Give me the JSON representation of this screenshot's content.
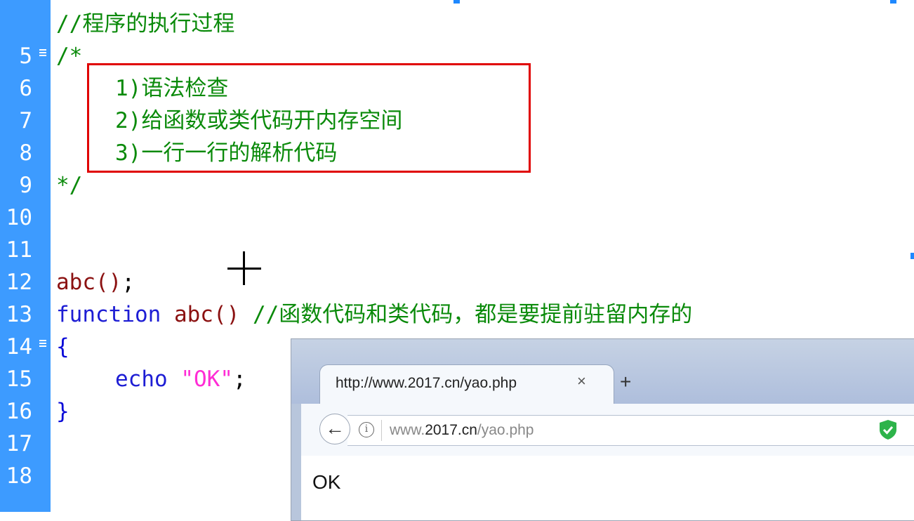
{
  "editor": {
    "lines": [
      {
        "num": "5",
        "text": "//程序的执行过程"
      },
      {
        "num": "6",
        "text": "/*"
      },
      {
        "num": "7",
        "text": "1)语法检查"
      },
      {
        "num": "8",
        "text": "2)给函数或类代码开内存空间"
      },
      {
        "num": "9",
        "text": "3)一行一行的解析代码"
      },
      {
        "num": "10",
        "text": "*/"
      },
      {
        "num": "11",
        "text": ""
      },
      {
        "num": "12",
        "text": ""
      },
      {
        "num": "13",
        "call": "abc",
        "paren": "()",
        "semi": ";"
      },
      {
        "num": "14",
        "kw": "function",
        "name": "abc",
        "paren": "()",
        "comment": "//函数代码和类代码，都是要提前驻留内存的"
      },
      {
        "num": "15",
        "text": "{"
      },
      {
        "num": "16",
        "kw": "echo",
        "str": "\"OK\"",
        "semi": ";"
      },
      {
        "num": "17",
        "text": "}"
      },
      {
        "num": "18",
        "text": ""
      }
    ],
    "colors": {
      "gutter": "#3d9bff",
      "comment": "#0a8a0a",
      "keyword": "#1d1dd4",
      "function_name": "#8b1111",
      "string": "#ff2dd5",
      "highlight_box": "#e00000"
    }
  },
  "browser": {
    "tab_title": "http://www.2017.cn/yao.php",
    "tab_close": "×",
    "new_tab": "+",
    "back": "←",
    "info_icon": "i",
    "url_prefix": "www.",
    "url_domain": "2017.cn",
    "url_path": "/yao.php",
    "page_content": "OK",
    "shield_color": "#2db34a"
  }
}
